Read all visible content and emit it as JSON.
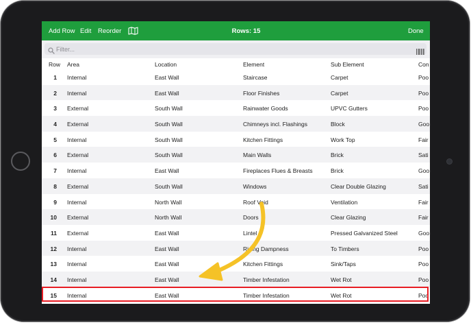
{
  "toolbar": {
    "add_row_label": "Add Row",
    "edit_label": "Edit",
    "reorder_label": "Reorder",
    "map_icon": "map-icon",
    "title": "Rows: 15",
    "done_label": "Done"
  },
  "search": {
    "placeholder": "Filter...",
    "value": "",
    "search_icon": "search-icon",
    "barcode_icon": "barcode-icon"
  },
  "table": {
    "columns": [
      "Row",
      "Area",
      "Location",
      "Element",
      "Sub Element",
      "Con"
    ],
    "rows": [
      [
        "1",
        "Internal",
        "East Wall",
        "Staircase",
        "Carpet",
        "Poo"
      ],
      [
        "2",
        "Internal",
        "East Wall",
        "Floor Finishes",
        "Carpet",
        "Poo"
      ],
      [
        "3",
        "External",
        "South Wall",
        "Rainwater Goods",
        "UPVC Gutters",
        "Poo"
      ],
      [
        "4",
        "External",
        "South Wall",
        "Chimneys incl. Flashings",
        "Block",
        "Goo"
      ],
      [
        "5",
        "Internal",
        "South Wall",
        "Kitchen Fittings",
        "Work Top",
        "Fair"
      ],
      [
        "6",
        "External",
        "South Wall",
        "Main Walls",
        "Brick",
        "Sati"
      ],
      [
        "7",
        "Internal",
        "East Wall",
        "Fireplaces Flues & Breasts",
        "Brick",
        "Goo"
      ],
      [
        "8",
        "External",
        "South Wall",
        "Windows",
        "Clear Double Glazing",
        "Sati"
      ],
      [
        "9",
        "Internal",
        "North Wall",
        "Roof Void",
        "Ventilation",
        "Fair"
      ],
      [
        "10",
        "External",
        "North Wall",
        "Doors",
        "Clear Glazing",
        "Fair"
      ],
      [
        "11",
        "External",
        "East Wall",
        "Lintel",
        "Pressed Galvanized Steel",
        "Goo"
      ],
      [
        "12",
        "Internal",
        "East Wall",
        "Rising Dampness",
        "To Timbers",
        "Poo"
      ],
      [
        "13",
        "Internal",
        "East Wall",
        "Kitchen Fittings",
        "Sink/Taps",
        "Poo"
      ],
      [
        "14",
        "Internal",
        "East Wall",
        "Timber Infestation",
        "Wet Rot",
        "Poo"
      ],
      [
        "15",
        "Internal",
        "East Wall",
        "Timber Infestation",
        "Wet Rot",
        "Poo"
      ]
    ],
    "highlighted_row": "15"
  },
  "colors": {
    "navbar": "#1f9e3d",
    "highlight_border": "#e81d24",
    "arrow": "#f5c227"
  }
}
